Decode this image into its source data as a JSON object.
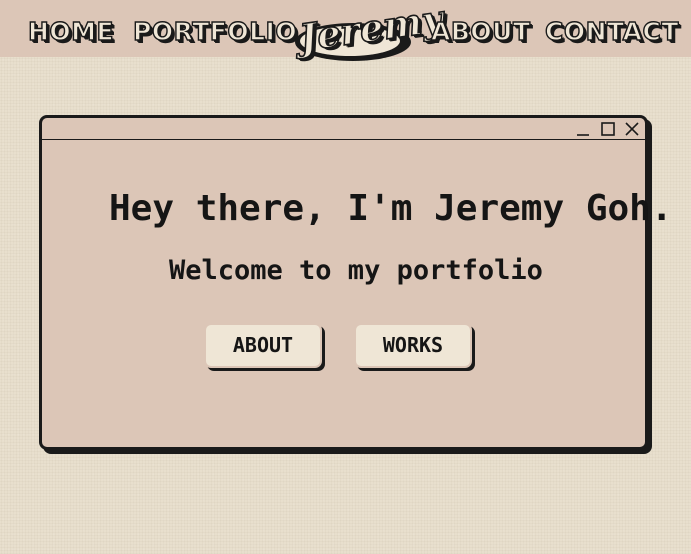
{
  "nav": {
    "home_label": "HOME",
    "portfolio_label": "PORTFOLIO",
    "logo_text": "Jeremy",
    "about_label": "ABOUT",
    "contact_label": "CONTACT"
  },
  "window": {
    "heading": "Hey there, I'm Jeremy Goh.",
    "subheading": "Welcome to my portfolio",
    "buttons": {
      "about_label": "ABOUT",
      "works_label": "WORKS"
    },
    "controls": [
      "minimize-icon",
      "maximize-icon",
      "close-icon"
    ]
  },
  "colors": {
    "background": "#e8dfcd",
    "nav_background": "#dcc6b7",
    "window_background": "#dcc6b7",
    "button_background": "#efe6d6",
    "ink": "#1a1a1a"
  }
}
